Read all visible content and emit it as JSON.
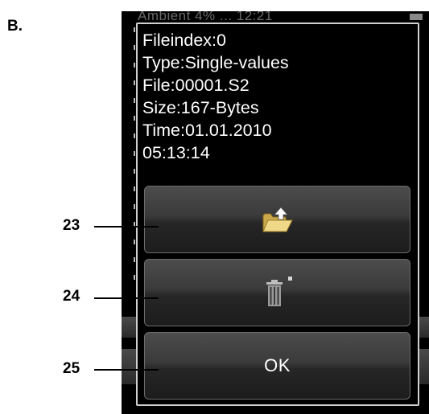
{
  "figure_label": "B.",
  "callouts": [
    "23",
    "24",
    "25"
  ],
  "status_bar": {
    "text": "Ambient 4% ... 12:21"
  },
  "dialog": {
    "info_lines": [
      "Fileindex:0",
      "Type:Single-values",
      "File:00001.S2",
      "Size:167-Bytes",
      "Time:01.01.2010",
      "05:13:14"
    ],
    "buttons": {
      "open_icon": "folder-upload-icon",
      "delete_icon": "trash-icon",
      "ok_label": "OK"
    }
  },
  "colors": {
    "screen_background": "#000000",
    "text": "#ffffff",
    "button_top": "#4c4c4c",
    "button_bottom": "#1c1c1c"
  }
}
